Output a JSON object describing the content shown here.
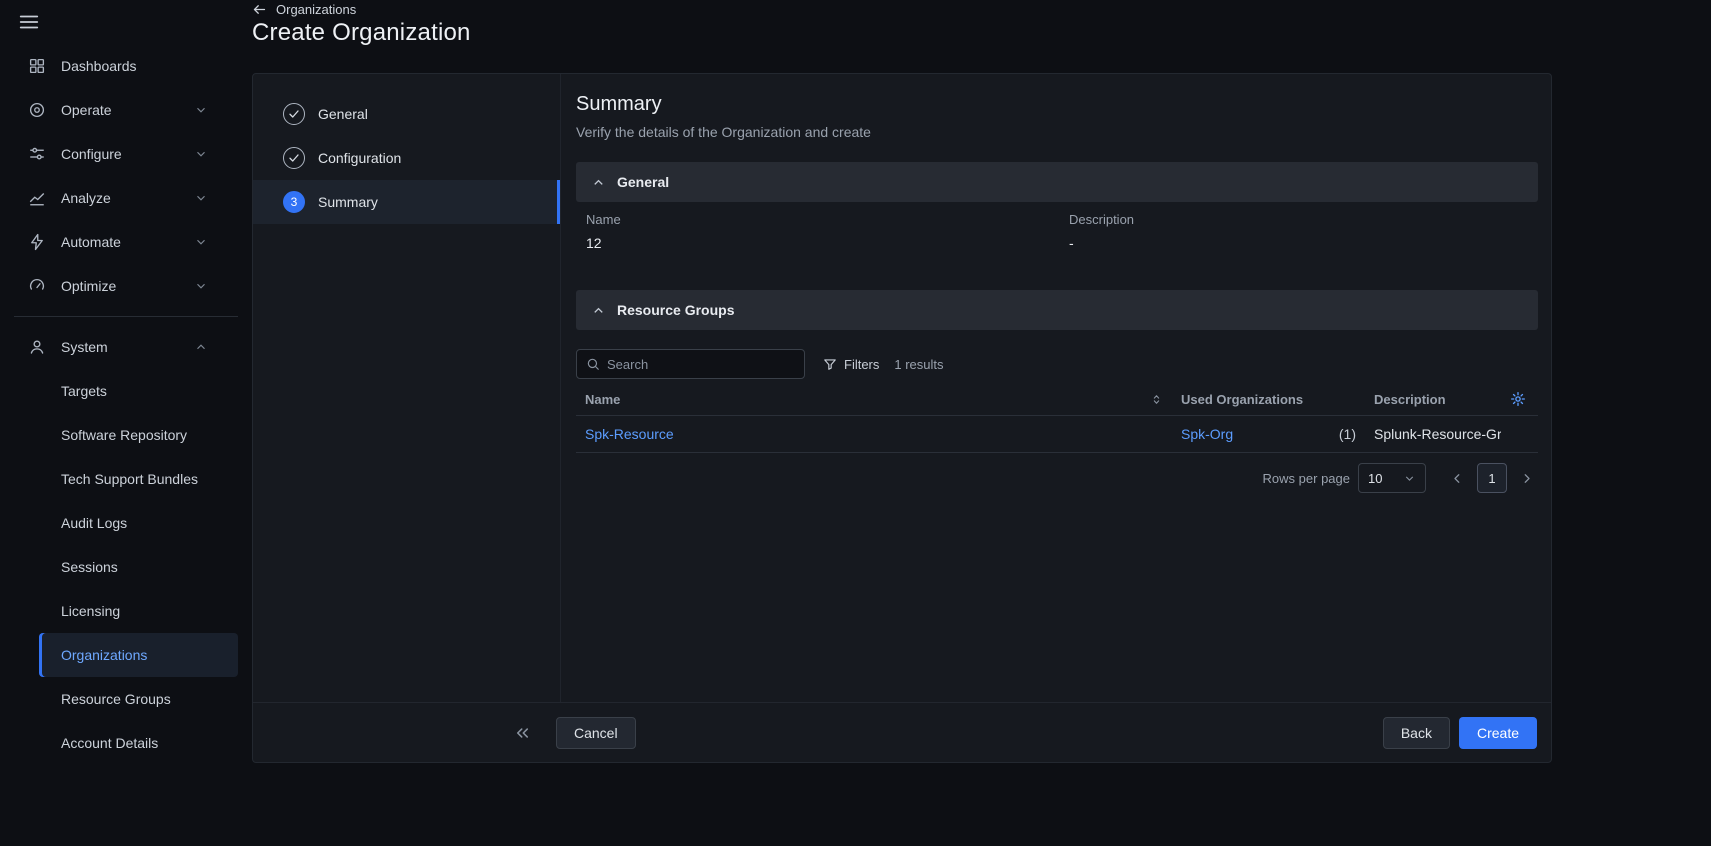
{
  "topbar": {
    "breadcrumb": "Organizations",
    "title": "Create Organization"
  },
  "sidebar": {
    "items": [
      {
        "label": "Dashboards",
        "icon": "dashboards-icon",
        "expandable": false
      },
      {
        "label": "Operate",
        "icon": "operate-icon",
        "expandable": true
      },
      {
        "label": "Configure",
        "icon": "configure-icon",
        "expandable": true
      },
      {
        "label": "Analyze",
        "icon": "analyze-icon",
        "expandable": true
      },
      {
        "label": "Automate",
        "icon": "automate-icon",
        "expandable": true
      },
      {
        "label": "Optimize",
        "icon": "optimize-icon",
        "expandable": true
      }
    ],
    "system_group": {
      "label": "System",
      "icon": "system-icon",
      "expanded": true,
      "children": [
        {
          "label": "Targets",
          "active": false
        },
        {
          "label": "Software Repository",
          "active": false
        },
        {
          "label": "Tech Support Bundles",
          "active": false
        },
        {
          "label": "Audit Logs",
          "active": false
        },
        {
          "label": "Sessions",
          "active": false
        },
        {
          "label": "Licensing",
          "active": false
        },
        {
          "label": "Organizations",
          "active": true
        },
        {
          "label": "Resource Groups",
          "active": false
        },
        {
          "label": "Account Details",
          "active": false
        }
      ]
    }
  },
  "wizard": {
    "steps": [
      {
        "label": "General",
        "state": "complete"
      },
      {
        "label": "Configuration",
        "state": "complete"
      },
      {
        "label": "Summary",
        "state": "active",
        "number": "3"
      }
    ]
  },
  "summary": {
    "heading": "Summary",
    "subheading": "Verify the details of the Organization and create",
    "general": {
      "title": "General",
      "name_label": "Name",
      "name_value": "12",
      "description_label": "Description",
      "description_value": "-"
    },
    "resource_groups": {
      "title": "Resource Groups",
      "search_placeholder": "Search",
      "filters_label": "Filters",
      "results_text": "1 results",
      "table": {
        "columns": [
          "Name",
          "Used Organizations",
          "Description"
        ],
        "rows": [
          {
            "name": "Spk-Resource",
            "used_organization": "Spk-Org",
            "used_count": "(1)",
            "description": "Splunk-Resource-Grou"
          }
        ]
      },
      "pagination": {
        "rows_per_page_label": "Rows per page",
        "rows_per_page_value": "10",
        "current_page": "1"
      }
    }
  },
  "footer": {
    "cancel_label": "Cancel",
    "back_label": "Back",
    "create_label": "Create"
  },
  "colors": {
    "accent_blue": "#3273f5",
    "link_blue": "#5c9dff",
    "active_nav_blue": "#6ea8ff",
    "page_bg": "#0d0f14",
    "card_bg": "#16191f",
    "section_bar_bg": "#272b33",
    "text_primary": "#dfe3e8",
    "text_secondary": "#9aa2ae"
  }
}
